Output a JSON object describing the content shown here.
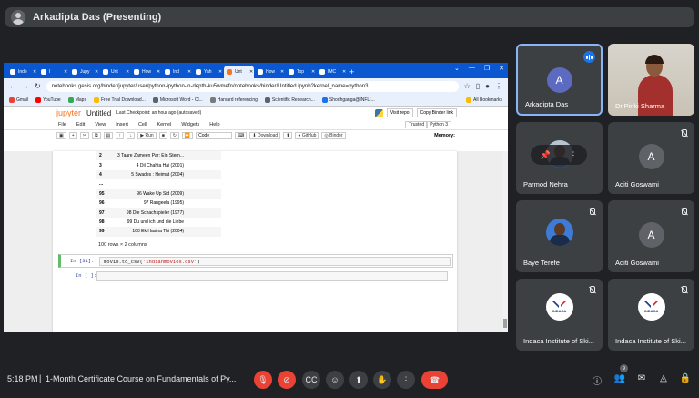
{
  "presenter": {
    "name": "Arkadipta Das (Presenting)"
  },
  "browser": {
    "tabs": [
      {
        "label": "Inde",
        "active": false
      },
      {
        "label": "I",
        "active": false
      },
      {
        "label": "Jupy",
        "active": false
      },
      {
        "label": "Unt",
        "active": false
      },
      {
        "label": "How",
        "active": false
      },
      {
        "label": "Ind",
        "active": false
      },
      {
        "label": "Yah",
        "active": false
      },
      {
        "label": "Unt",
        "active": true
      },
      {
        "label": "How",
        "active": false
      },
      {
        "label": "Top",
        "active": false
      },
      {
        "label": "IMC",
        "active": false
      }
    ],
    "new_tab": "+",
    "url": "notebooks.gesis.org/binder/jupyter/user/python-ipython-in-depth-ku5wmefn/notebooks/binder/Untitled.ipynb?kernel_name=python3",
    "bookmarks": [
      "Gmail",
      "YouTube",
      "Maps",
      "Free Trial Download...",
      "Microsoft Word - Cl...",
      "Harvard referencing",
      "Scientific Research...",
      "Shodhganga@INFLI..."
    ],
    "all_bookmarks": "All Bookmarks"
  },
  "jupyter": {
    "logo": "jupyter",
    "title": "Untitled",
    "checkpoint": "Last Checkpoint: an hour ago  (autosaved)",
    "visit_repo": "Visit repo",
    "copy_binder": "Copy Binder link",
    "menu": [
      "File",
      "Edit",
      "View",
      "Insert",
      "Cell",
      "Kernel",
      "Widgets",
      "Help"
    ],
    "trusted": "Trusted",
    "kernel": "Python 3",
    "run_label": "Run",
    "cell_type": "Code",
    "download": "Download",
    "github": "GitHub",
    "binder": "Binder",
    "memory": "Memory:",
    "table_rows": [
      {
        "idx": "2",
        "c1": "3  Taare Zameen Par: Ein Stern...",
        "c2": ""
      },
      {
        "idx": "3",
        "c1": "4  Dil Chahta Hai (2001)",
        "c2": ""
      },
      {
        "idx": "4",
        "c1": "5  Swades : Heimat (2004)",
        "c2": ""
      },
      {
        "idx": "...",
        "c1": "",
        "c2": ""
      },
      {
        "idx": "95",
        "c1": "96  Wake Up Sid (2009)",
        "c2": ""
      },
      {
        "idx": "96",
        "c1": "97  Rangeela (1995)",
        "c2": ""
      },
      {
        "idx": "97",
        "c1": "98  Die Schachspieler (1977)",
        "c2": ""
      },
      {
        "idx": "98",
        "c1": "99  Du und ich und die Liebe",
        "c2": ""
      },
      {
        "idx": "99",
        "c1": "100  Ek Hasina Thi (2004)",
        "c2": ""
      }
    ],
    "row_count": "100 rows × 2 columns",
    "cell1_prompt": "In [31]:",
    "cell1_code_pre": "movie.to_csv(",
    "cell1_code_str": "'indianmovies.csv'",
    "cell1_code_post": ")",
    "cell2_prompt": "In [ ]:"
  },
  "participants": [
    {
      "name": "Arkadipta Das",
      "letter": "A",
      "color": "#5c6bc0",
      "type": "letter",
      "speaking": true
    },
    {
      "name": "Dr.Pinki Sharma",
      "type": "video"
    },
    {
      "name": "Parmod Nehra",
      "type": "photo"
    },
    {
      "name": "Aditi Goswami",
      "letter": "A",
      "color": "#5f6368",
      "type": "letter"
    },
    {
      "name": "Baye Terefe",
      "type": "photo"
    },
    {
      "name": "Aditi Goswami",
      "letter": "A",
      "color": "#5f6368",
      "type": "letter"
    },
    {
      "name": "Indaca Institute of Ski...",
      "type": "logo",
      "logo_text": "INDACA"
    },
    {
      "name": "Indaca Institute of Ski...",
      "type": "logo",
      "logo_text": "INDACA"
    }
  ],
  "bottom": {
    "time": "5:18 PM",
    "separator": "|",
    "meeting_title": "1-Month Certificate Course on Fundamentals of Py...",
    "participant_badge": "9"
  }
}
